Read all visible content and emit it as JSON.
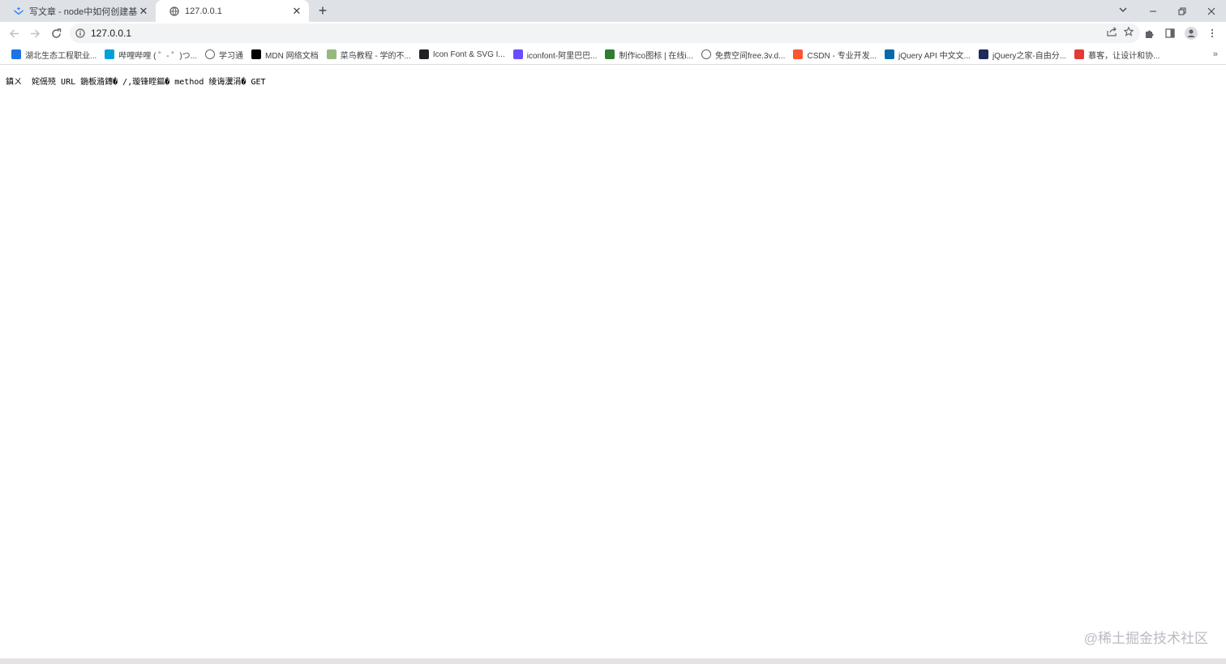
{
  "tabs": [
    {
      "title": "写文章 - node中如何创建基本的",
      "favicon": "juejin-icon",
      "active": false
    },
    {
      "title": "127.0.0.1",
      "favicon": "globe-icon",
      "active": true
    }
  ],
  "address_bar": {
    "url": "127.0.0.1"
  },
  "bookmarks": [
    {
      "label": "湖北生态工程职业...",
      "icon": "school-icon",
      "color": "#1a73e8"
    },
    {
      "label": "哔哩哔哩 ( ゜- ゜)つ...",
      "icon": "bilibili-icon",
      "color": "#00a1d6"
    },
    {
      "label": "学习通",
      "icon": "globe-icon",
      "color": "#5f6368"
    },
    {
      "label": "MDN 网络文档",
      "icon": "mdn-icon",
      "color": "#000000"
    },
    {
      "label": "菜鸟教程 - 学的不...",
      "icon": "runoob-icon",
      "color": "#96b97d"
    },
    {
      "label": "Icon Font & SVG I...",
      "icon": "iconfont-icon",
      "color": "#202124"
    },
    {
      "label": "iconfont-阿里巴巴...",
      "icon": "alibaba-iconfont-icon",
      "color": "#6a4dff"
    },
    {
      "label": "制作ico图标 | 在线i...",
      "icon": "bitbug-icon",
      "color": "#2e7d32"
    },
    {
      "label": "免费空间free.3v.d...",
      "icon": "globe-icon",
      "color": "#5f6368"
    },
    {
      "label": "CSDN - 专业开发...",
      "icon": "csdn-icon",
      "color": "#fc5531"
    },
    {
      "label": "jQuery API 中文文...",
      "icon": "jquery-icon",
      "color": "#0769ad"
    },
    {
      "label": "jQuery之家-自由分...",
      "icon": "jquery22-icon",
      "color": "#1e2a5a"
    },
    {
      "label": "慕客，让设计和协...",
      "icon": "mockplus-icon",
      "color": "#e53935"
    }
  ],
  "page": {
    "text": "鎮ㄨ  姹傜殑 URL 鍦板潃鏄� /,璇锋眰鏂� method 绫诲瀷涓� GET"
  },
  "watermark": "@稀土掘金技术社区",
  "colors": {
    "tabstrip": "#dee1e6",
    "omnibox": "#f1f3f4",
    "accent": "#1a73e8"
  }
}
